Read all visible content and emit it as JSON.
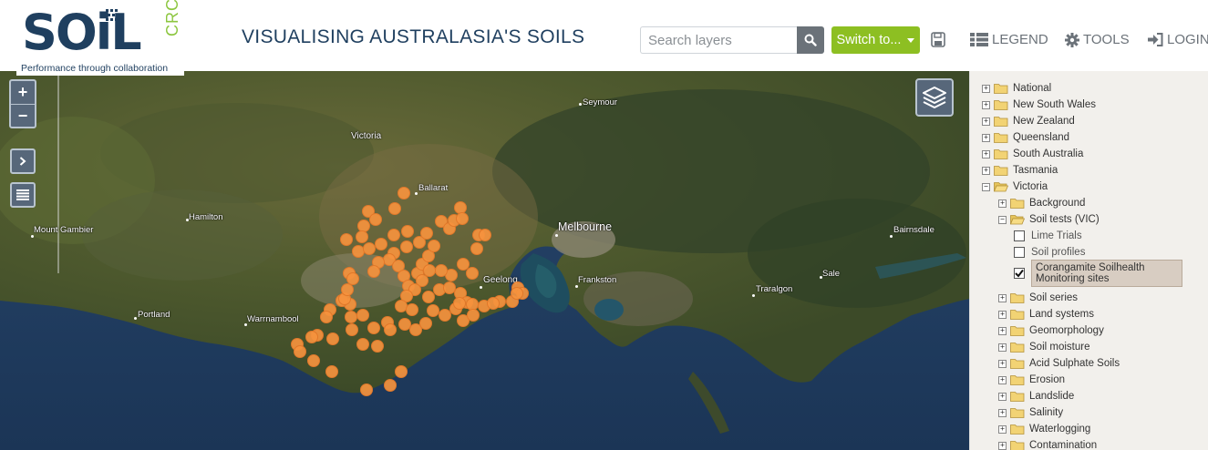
{
  "header": {
    "logo_main": "SOiL",
    "logo_sub": "CRC",
    "logo_tagline": "Performance through collaboration",
    "title": "VISUALISING AUSTRALASIA'S SOILS",
    "search_placeholder": "Search layers",
    "switch_label": "Switch to...",
    "legend_label": "LEGEND",
    "tools_label": "TOOLS",
    "login_label": "LOGIN",
    "accent_green": "#8dbf22",
    "brand_navy": "#1f3f5f"
  },
  "map": {
    "places": [
      {
        "name": "Victoria",
        "size": "mid"
      },
      {
        "name": "Seymour",
        "size": "small"
      },
      {
        "name": "Ballarat",
        "size": "small"
      },
      {
        "name": "Hamilton",
        "size": "small"
      },
      {
        "name": "Mount Gambier",
        "size": "small"
      },
      {
        "name": "Melbourne",
        "size": "big"
      },
      {
        "name": "Bairnsdale",
        "size": "small"
      },
      {
        "name": "Geelong",
        "size": "mid"
      },
      {
        "name": "Frankston",
        "size": "small"
      },
      {
        "name": "Sale",
        "size": "small"
      },
      {
        "name": "Traralgon",
        "size": "small"
      },
      {
        "name": "Portland",
        "size": "small"
      },
      {
        "name": "Warrnambool",
        "size": "small"
      }
    ],
    "marker_color": "#f5923e"
  },
  "tree": {
    "items": [
      {
        "label": "National",
        "level": 0,
        "expanded": false
      },
      {
        "label": "New South Wales",
        "level": 0,
        "expanded": false
      },
      {
        "label": "New Zealand",
        "level": 0,
        "expanded": false
      },
      {
        "label": "Queensland",
        "level": 0,
        "expanded": false
      },
      {
        "label": "South Australia",
        "level": 0,
        "expanded": false
      },
      {
        "label": "Tasmania",
        "level": 0,
        "expanded": false
      },
      {
        "label": "Victoria",
        "level": 0,
        "expanded": true
      },
      {
        "label": "Background",
        "level": 1,
        "expanded": false
      },
      {
        "label": "Soil tests (VIC)",
        "level": 1,
        "expanded": true
      },
      {
        "label": "Lime Trials",
        "level": 2,
        "checked": false
      },
      {
        "label": "Soil profiles",
        "level": 2,
        "checked": false
      },
      {
        "label": "Corangamite Soilhealth Monitoring sites",
        "level": 2,
        "checked": true
      },
      {
        "label": "Soil series",
        "level": 1,
        "expanded": false
      },
      {
        "label": "Land systems",
        "level": 1,
        "expanded": false
      },
      {
        "label": "Geomorphology",
        "level": 1,
        "expanded": false
      },
      {
        "label": "Soil moisture",
        "level": 1,
        "expanded": false
      },
      {
        "label": "Acid Sulphate Soils",
        "level": 1,
        "expanded": false
      },
      {
        "label": "Erosion",
        "level": 1,
        "expanded": false
      },
      {
        "label": "Landslide",
        "level": 1,
        "expanded": false
      },
      {
        "label": "Salinity",
        "level": 1,
        "expanded": false
      },
      {
        "label": "Waterlogging",
        "level": 1,
        "expanded": false
      },
      {
        "label": "Contamination",
        "level": 1,
        "expanded": false
      }
    ]
  }
}
